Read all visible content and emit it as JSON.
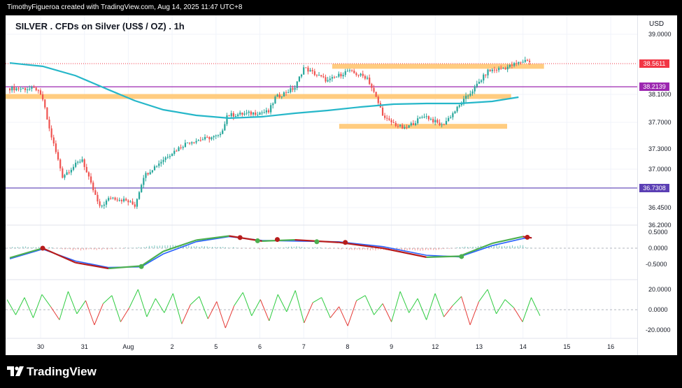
{
  "header": {
    "credit": "TimothyFigueroa created with TradingView.com, Aug 14, 2025 11:47 UTC+8"
  },
  "footer": {
    "brand": "TradingView"
  },
  "colors": {
    "accent_ma": "#26b7c9",
    "zone": "#ffcc80",
    "level_line": "#9c27b0",
    "level_line2": "#5b3fb4",
    "up": "#26a69a",
    "down": "#ef5350",
    "current": "#f23645"
  },
  "icons": {
    "logo": "tradingview-logo-icon"
  },
  "chart_data": {
    "type": "candlestick",
    "title": "SILVER . CFDs on Silver (US$ / OZ) . 1h",
    "currency": "USD",
    "x_ticks": [
      "30",
      "31",
      "Aug",
      "2",
      "5",
      "6",
      "7",
      "8",
      "9",
      "12",
      "13",
      "14",
      "15",
      "16"
    ],
    "y_ticks": [
      "39.0000",
      "38.1000",
      "37.7000",
      "37.3000",
      "37.0000",
      "36.4500",
      "36.2000"
    ],
    "y_range": [
      36.2,
      39.0
    ],
    "price_tags": [
      {
        "value": "38.5611",
        "kind": "current"
      },
      {
        "value": "38.2139",
        "kind": "level"
      },
      {
        "value": "36.7308",
        "kind": "level"
      }
    ],
    "horizontal_lines": [
      38.2139,
      36.7308
    ],
    "zones": [
      {
        "from": "7",
        "to": "14",
        "price": 38.52
      },
      {
        "from": "30",
        "to": "13",
        "price": 38.07
      },
      {
        "from": "7",
        "to": "13",
        "price": 37.64
      }
    ],
    "price_path": [
      {
        "x": 0,
        "y": 38.19
      },
      {
        "x": 1.2,
        "y": 38.18
      },
      {
        "x": 1.5,
        "y": 38.03
      },
      {
        "x": 1.8,
        "y": 37.6
      },
      {
        "x": 2.4,
        "y": 36.9
      },
      {
        "x": 3.3,
        "y": 37.15
      },
      {
        "x": 3.5,
        "y": 36.95
      },
      {
        "x": 4.1,
        "y": 36.45
      },
      {
        "x": 4.6,
        "y": 36.6
      },
      {
        "x": 5.3,
        "y": 36.55
      },
      {
        "x": 5.7,
        "y": 36.48
      },
      {
        "x": 6.1,
        "y": 36.9
      },
      {
        "x": 7.2,
        "y": 37.2
      },
      {
        "x": 8.1,
        "y": 37.4
      },
      {
        "x": 9.6,
        "y": 37.5
      },
      {
        "x": 9.9,
        "y": 37.8
      },
      {
        "x": 11.8,
        "y": 37.85
      },
      {
        "x": 12.1,
        "y": 38.05
      },
      {
        "x": 13,
        "y": 38.2
      },
      {
        "x": 13.4,
        "y": 38.5
      },
      {
        "x": 14.5,
        "y": 38.3
      },
      {
        "x": 15.4,
        "y": 38.45
      },
      {
        "x": 16.3,
        "y": 38.35
      },
      {
        "x": 17.1,
        "y": 37.75
      },
      {
        "x": 18.0,
        "y": 37.6
      },
      {
        "x": 18.9,
        "y": 37.8
      },
      {
        "x": 19.7,
        "y": 37.65
      },
      {
        "x": 20.4,
        "y": 37.9
      },
      {
        "x": 21.2,
        "y": 38.2
      },
      {
        "x": 21.8,
        "y": 38.45
      },
      {
        "x": 22.6,
        "y": 38.5
      },
      {
        "x": 23.6,
        "y": 38.62
      },
      {
        "x": 23.8,
        "y": 38.56
      }
    ],
    "moving_average": [
      {
        "x": 0,
        "y": 38.57
      },
      {
        "x": 1.5,
        "y": 38.52
      },
      {
        "x": 3,
        "y": 38.38
      },
      {
        "x": 4.5,
        "y": 38.17
      },
      {
        "x": 5.7,
        "y": 38.01
      },
      {
        "x": 7,
        "y": 37.88
      },
      {
        "x": 8.5,
        "y": 37.8
      },
      {
        "x": 10,
        "y": 37.76
      },
      {
        "x": 11.5,
        "y": 37.78
      },
      {
        "x": 13,
        "y": 37.83
      },
      {
        "x": 14.5,
        "y": 37.87
      },
      {
        "x": 16,
        "y": 37.92
      },
      {
        "x": 17.5,
        "y": 37.96
      },
      {
        "x": 19,
        "y": 37.97
      },
      {
        "x": 20.5,
        "y": 37.97
      },
      {
        "x": 22,
        "y": 38.0
      },
      {
        "x": 23.2,
        "y": 38.06
      }
    ],
    "oscillator_1": {
      "y_ticks": [
        "0.5000",
        "0.0000",
        "-0.5000"
      ],
      "y_range": [
        -0.8,
        0.6
      ],
      "line_a": [
        {
          "x": 0,
          "y": -0.3
        },
        {
          "x": 1.5,
          "y": 0.0
        },
        {
          "x": 3,
          "y": -0.45
        },
        {
          "x": 4.5,
          "y": -0.63
        },
        {
          "x": 6,
          "y": -0.55
        },
        {
          "x": 7,
          "y": -0.1
        },
        {
          "x": 8.5,
          "y": 0.25
        },
        {
          "x": 10,
          "y": 0.38
        },
        {
          "x": 11.5,
          "y": 0.22
        },
        {
          "x": 13,
          "y": 0.26
        },
        {
          "x": 15,
          "y": 0.18
        },
        {
          "x": 17,
          "y": 0.0
        },
        {
          "x": 19,
          "y": -0.28
        },
        {
          "x": 20.5,
          "y": -0.25
        },
        {
          "x": 22,
          "y": 0.15
        },
        {
          "x": 23.4,
          "y": 0.36
        },
        {
          "x": 23.8,
          "y": 0.32
        }
      ],
      "line_b": [
        {
          "x": 0,
          "y": -0.33
        },
        {
          "x": 1.5,
          "y": -0.03
        },
        {
          "x": 3,
          "y": -0.4
        },
        {
          "x": 4.5,
          "y": -0.6
        },
        {
          "x": 6,
          "y": -0.58
        },
        {
          "x": 7,
          "y": -0.18
        },
        {
          "x": 8.5,
          "y": 0.2
        },
        {
          "x": 10,
          "y": 0.36
        },
        {
          "x": 11.5,
          "y": 0.24
        },
        {
          "x": 13,
          "y": 0.22
        },
        {
          "x": 15,
          "y": 0.2
        },
        {
          "x": 17,
          "y": 0.05
        },
        {
          "x": 19,
          "y": -0.22
        },
        {
          "x": 20.5,
          "y": -0.27
        },
        {
          "x": 22,
          "y": 0.08
        },
        {
          "x": 23.4,
          "y": 0.3
        },
        {
          "x": 23.8,
          "y": 0.33
        }
      ],
      "cross_dots": [
        {
          "x": 1.5,
          "y": 0.0,
          "kind": "down"
        },
        {
          "x": 6.0,
          "y": -0.57,
          "kind": "up"
        },
        {
          "x": 10.5,
          "y": 0.33,
          "kind": "down"
        },
        {
          "x": 11.3,
          "y": 0.23,
          "kind": "up"
        },
        {
          "x": 12.2,
          "y": 0.27,
          "kind": "down"
        },
        {
          "x": 14.0,
          "y": 0.2,
          "kind": "up"
        },
        {
          "x": 15.3,
          "y": 0.18,
          "kind": "down"
        },
        {
          "x": 20.6,
          "y": -0.26,
          "kind": "up"
        },
        {
          "x": 23.6,
          "y": 0.34,
          "kind": "down"
        }
      ]
    },
    "oscillator_2": {
      "y_ticks": [
        "20.0000",
        "0.0000",
        "-20.0000"
      ],
      "y_range": [
        -25,
        25
      ],
      "values": [
        10,
        -5,
        12,
        -8,
        15,
        3,
        -10,
        18,
        -4,
        9,
        -15,
        6,
        14,
        -12,
        2,
        20,
        -7,
        11,
        -3,
        16,
        -14,
        5,
        13,
        -9,
        8,
        -18,
        4,
        17,
        -6,
        10,
        -11,
        15,
        -2,
        19,
        -13,
        7,
        12,
        -8,
        3,
        -16,
        9,
        14,
        -5,
        6,
        -12,
        18,
        -3,
        11,
        -10,
        16,
        -7,
        4,
        13,
        -15,
        8,
        20,
        -4,
        10,
        2,
        -12,
        12,
        -6
      ]
    }
  }
}
